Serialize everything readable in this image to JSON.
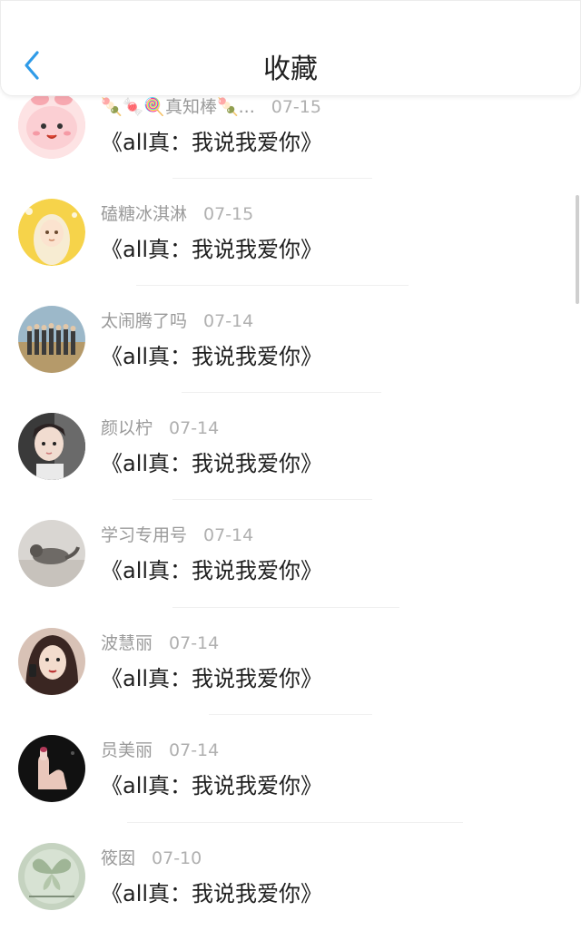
{
  "header": {
    "title": "收藏",
    "back_icon": "chevron-left-icon",
    "accent": "#2f9be8"
  },
  "items": [
    {
      "name": "🍡🍬🍭真知棒🍡...",
      "date": "07-15",
      "text": "《all真：我说我爱你》",
      "avatar": "pink-cartoon-avatar"
    },
    {
      "name": "磕糖冰淇淋",
      "date": "07-15",
      "text": "《all真：我说我爱你》",
      "avatar": "anime-girl-avatar"
    },
    {
      "name": "太闹腾了吗",
      "date": "07-14",
      "text": "《all真：我说我爱你》",
      "avatar": "group-photo-avatar"
    },
    {
      "name": "颜以柠",
      "date": "07-14",
      "text": "《all真：我说我爱你》",
      "avatar": "boy-portrait-avatar"
    },
    {
      "name": "学习专用号",
      "date": "07-14",
      "text": "《all真：我说我爱你》",
      "avatar": "cat-photo-avatar"
    },
    {
      "name": "波慧丽",
      "date": "07-14",
      "text": "《all真：我说我爱你》",
      "avatar": "woman-portrait-avatar"
    },
    {
      "name": "员美丽",
      "date": "07-14",
      "text": "《all真：我说我爱你》",
      "avatar": "dark-hand-avatar"
    },
    {
      "name": "筱囡",
      "date": "07-10",
      "text": "《all真：我说我爱你》",
      "avatar": "butterfly-avatar"
    }
  ]
}
